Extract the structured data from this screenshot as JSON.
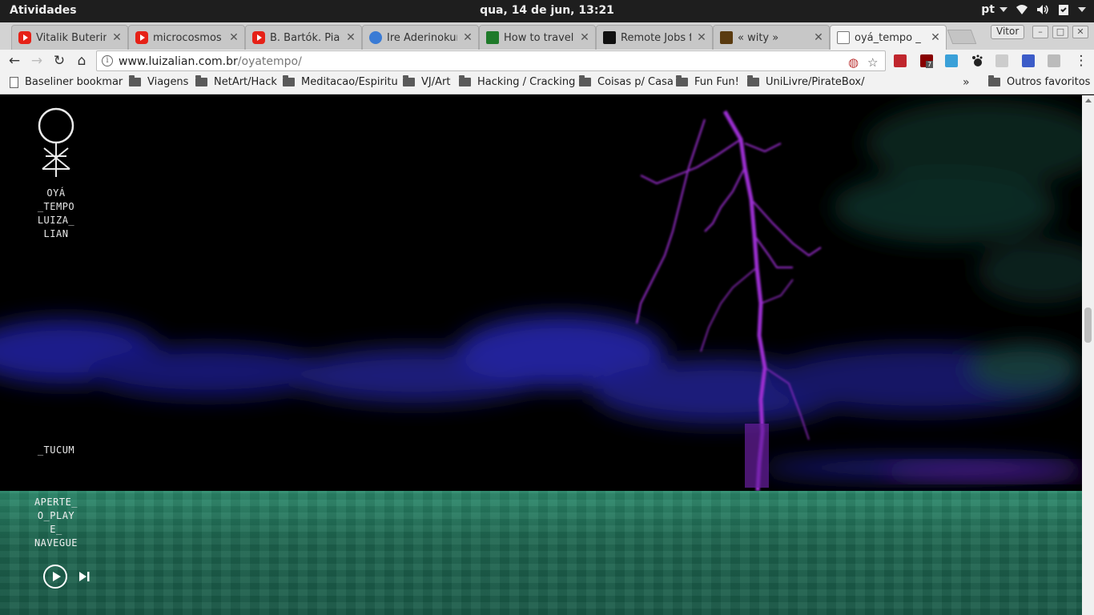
{
  "system": {
    "activities": "Atividades",
    "clock": "qua, 14 de jun, 13:21",
    "language": "pt"
  },
  "browser": {
    "tabs": [
      {
        "title": "Vitalik Buterin",
        "favicon": "youtube-icon"
      },
      {
        "title": "microcosmos",
        "favicon": "youtube-icon"
      },
      {
        "title": "B. Bartók. Piar",
        "favicon": "youtube-icon"
      },
      {
        "title": "Ire Aderinokur",
        "favicon": "person-icon"
      },
      {
        "title": "How to travel",
        "favicon": "travel-icon"
      },
      {
        "title": "Remote Jobs fo",
        "favicon": "jobs-icon"
      },
      {
        "title": "« wity »",
        "favicon": "star-icon"
      },
      {
        "title": "oyá_tempo _ l",
        "favicon": "document-icon",
        "active": true
      }
    ],
    "profile_name": "Vitor",
    "url_host": "www.luizalian.com.br",
    "url_path": "/oyatempo/",
    "extension_badge": "7",
    "bookmarks": [
      {
        "label": "Baseliner bookmar",
        "type": "page"
      },
      {
        "label": "Viagens",
        "type": "folder"
      },
      {
        "label": "NetArt/Hack",
        "type": "folder"
      },
      {
        "label": "Meditacao/Espiritu",
        "type": "folder"
      },
      {
        "label": "VJ/Art",
        "type": "folder"
      },
      {
        "label": "Hacking / Cracking",
        "type": "folder"
      },
      {
        "label": "Coisas p/ Casa",
        "type": "folder"
      },
      {
        "label": "Fun Fun!",
        "type": "folder"
      },
      {
        "label": "UniLivre/PirateBox/",
        "type": "folder"
      }
    ],
    "bookmarks_overflow": "»",
    "other_bookmarks": "Outros favoritos"
  },
  "page": {
    "title_lines": "OYÁ\n_TEMPO\nLUIZA_\nLIAN",
    "tucum": "_TUCUM",
    "instructions": "APERTE_\nO_PLAY\nE_\nNAVEGUE",
    "colors": {
      "lightning": "#9b2fd0",
      "sea": "#22775c",
      "clouds": "#1a1a7a"
    }
  }
}
